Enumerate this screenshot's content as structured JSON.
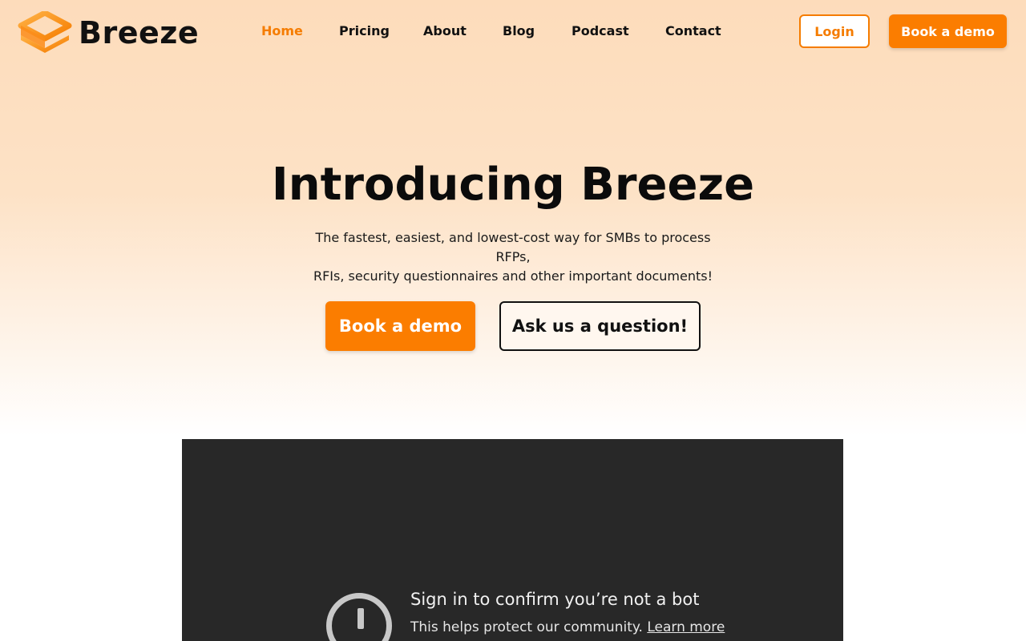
{
  "brand": {
    "name": "Breeze",
    "logo_icon": "stacked-layers-logo",
    "accent_color": "#fb7d00"
  },
  "nav": {
    "items": [
      {
        "label": "Home",
        "active": true
      },
      {
        "label": "Pricing",
        "active": false
      },
      {
        "label": "About",
        "active": false
      },
      {
        "label": "Blog",
        "active": false
      },
      {
        "label": "Podcast",
        "active": false
      },
      {
        "label": "Contact",
        "active": false
      }
    ],
    "login_label": "Login",
    "demo_label": "Book a demo"
  },
  "hero": {
    "title": "Introducing Breeze",
    "subtitle_line1": "The fastest, easiest, and lowest-cost way for SMBs to process RFPs,",
    "subtitle_line2": "RFIs, security questionnaires and other important documents!",
    "primary_cta": "Book a demo",
    "secondary_cta": "Ask us a question!"
  },
  "video": {
    "icon": "alert-circle-icon",
    "title": "Sign in to confirm you’re not a bot",
    "message": "This helps protect our community.",
    "link_label": "Learn more"
  }
}
